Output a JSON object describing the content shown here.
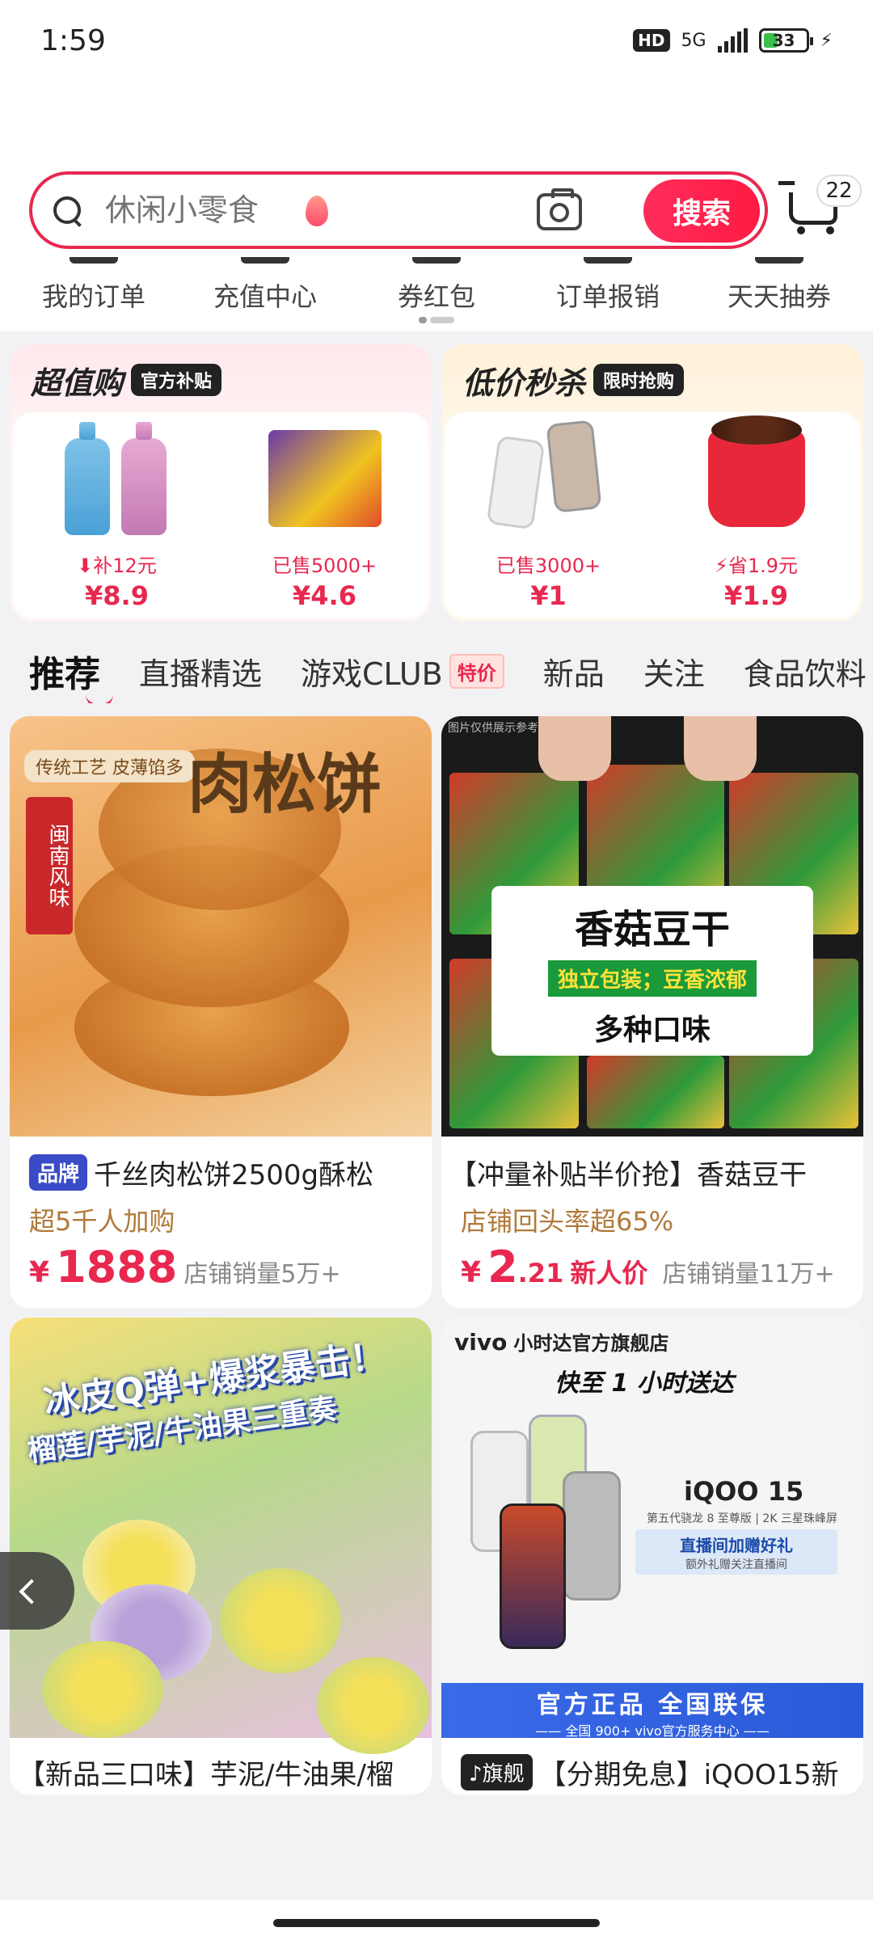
{
  "status_bar": {
    "time": "1:59",
    "hd": "HD",
    "network": "5G",
    "battery": "33"
  },
  "search": {
    "placeholder": "休闲小零食",
    "button_label": "搜索"
  },
  "cart": {
    "badge": "22"
  },
  "quick_nav": [
    {
      "label": "我的订单"
    },
    {
      "label": "充值中心"
    },
    {
      "label": "券红包"
    },
    {
      "label": "订单报销"
    },
    {
      "label": "天天抽券"
    }
  ],
  "promos": {
    "left": {
      "title": "超值购",
      "tag": "官方补贴",
      "products": [
        {
          "sub": "补12元",
          "price": "¥8.9"
        },
        {
          "sub": "已售5000+",
          "price": "¥4.6"
        }
      ]
    },
    "right": {
      "title": "低价秒杀",
      "tag": "限时抢购",
      "products": [
        {
          "sub": "已售3000+",
          "price": "¥1"
        },
        {
          "sub": "省1.9元",
          "price": "¥1.9"
        }
      ]
    }
  },
  "tabs": [
    {
      "label": "推荐",
      "active": true
    },
    {
      "label": "直播精选"
    },
    {
      "label": "游戏CLUB",
      "badge": "特价"
    },
    {
      "label": "新品"
    },
    {
      "label": "关注"
    },
    {
      "label": "食品饮料"
    }
  ],
  "products": [
    {
      "tag": "品牌",
      "title": "千丝肉松饼2500g酥松",
      "subtitle": "超5千人加购",
      "price": "1888",
      "sold": "店铺销量5万+",
      "image": {
        "banner": "传统工艺 皮薄馅多",
        "headline": "肉松饼",
        "seal": "闽南风味"
      }
    },
    {
      "title": "【冲量补贴半价抢】香菇豆干",
      "subtitle": "店铺回头率超65%",
      "price_int": "2",
      "price_dec": ".21",
      "newcomer": "新人价",
      "sold": "店铺销量11万+",
      "image": {
        "note": "图片仅供展示参考",
        "l1": "香菇豆干",
        "l2": "独立包装；豆香浓郁",
        "l3": "多种口味"
      }
    },
    {
      "title": "【新品三口味】芋泥/牛油果/榴",
      "image": {
        "line1": "冰皮Q弹+爆浆暴击！",
        "line2": "榴莲/芋泥/牛油果三重奏"
      }
    },
    {
      "tag": "旗舰",
      "title": "【分期免息】iQOO15新",
      "image": {
        "brand": "vivo",
        "store": "小时达官方旗舰店",
        "fast": "快至 1 小时送达",
        "model": "iQOO 15",
        "spec": "第五代骁龙 8 至尊版 | 2K 三星珠峰屏",
        "gift": "直播间加赠好礼",
        "gift_sub": "额外礼赠关注直播间",
        "bar1": "官方正品 全国联保",
        "bar2": "—— 全国 900+ vivo官方服务中心 ——"
      }
    }
  ],
  "colors": {
    "accent": "#e8284f",
    "brand_blue": "#3a4bc8"
  }
}
